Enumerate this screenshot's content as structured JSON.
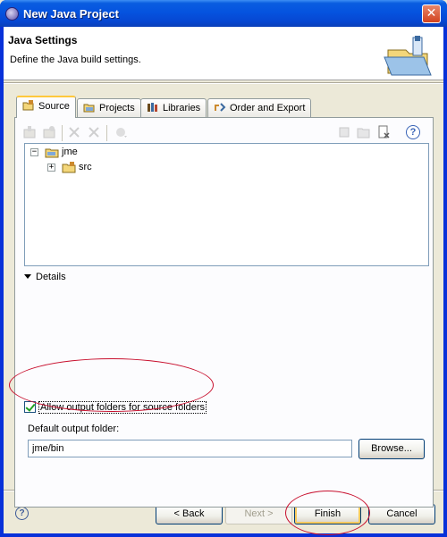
{
  "window": {
    "title": "New Java Project",
    "close_symbol": "✕"
  },
  "banner": {
    "title": "Java Settings",
    "description": "Define the Java build settings."
  },
  "tabs": [
    {
      "label": "Source",
      "icon": "source-folder-icon",
      "active": true
    },
    {
      "label": "Projects",
      "icon": "projects-icon",
      "active": false
    },
    {
      "label": "Libraries",
      "icon": "libraries-icon",
      "active": false
    },
    {
      "label": "Order and Export",
      "icon": "order-export-icon",
      "active": false
    }
  ],
  "toolbar": {
    "help_symbol": "?"
  },
  "tree": {
    "root": {
      "label": "jme",
      "expander": "−"
    },
    "child": {
      "label": "src",
      "expander": "+"
    }
  },
  "details": {
    "label": "Details"
  },
  "options": {
    "allow_output_folders_label": "Allow output folders for source folders",
    "allow_output_folders_checked": true,
    "default_output_label": "Default output folder:",
    "default_output_value": "jme/bin",
    "browse_label": "Browse..."
  },
  "footer": {
    "help_symbol": "?",
    "back_label": "< Back",
    "next_label": "Next >",
    "finish_label": "Finish",
    "cancel_label": "Cancel"
  },
  "colors": {
    "annotation": "#c8102e",
    "titlebar": "#0553df"
  }
}
